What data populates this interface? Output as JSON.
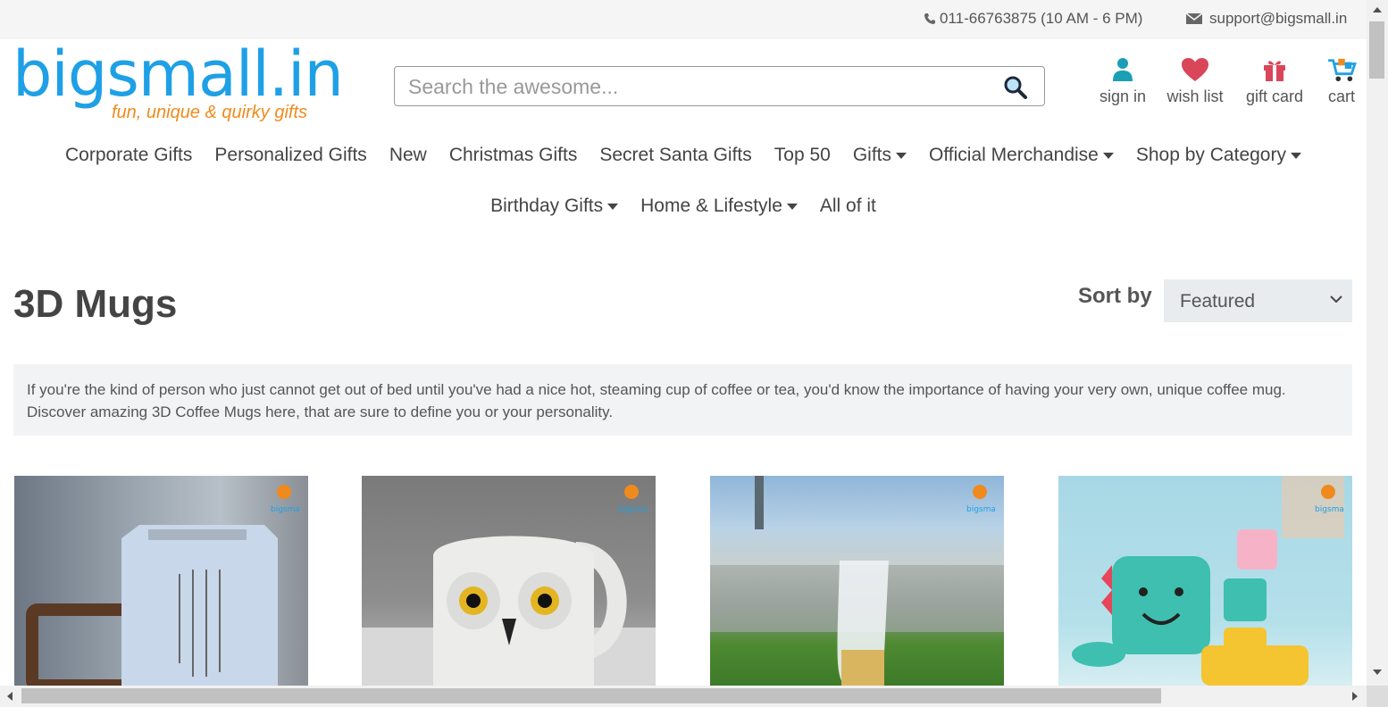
{
  "topbar": {
    "phone": "011-66763875 (10 AM - 6 PM)",
    "email": "support@bigsmall.in"
  },
  "logo": {
    "brand": "bigsmall.in",
    "tagline": "fun, unique & quirky gifts"
  },
  "search": {
    "placeholder": "Search the awesome...",
    "icon": "search-icon"
  },
  "header_links": [
    {
      "label": "sign in",
      "icon": "user-icon"
    },
    {
      "label": "wish list",
      "icon": "heart-icon"
    },
    {
      "label": "gift card",
      "icon": "gift-icon"
    },
    {
      "label": "cart",
      "icon": "cart-icon"
    }
  ],
  "nav": {
    "row1": [
      {
        "label": "Corporate Gifts",
        "dropdown": false
      },
      {
        "label": "Personalized Gifts",
        "dropdown": false
      },
      {
        "label": "New",
        "dropdown": false
      },
      {
        "label": "Christmas Gifts",
        "dropdown": false
      },
      {
        "label": "Secret Santa Gifts",
        "dropdown": false
      },
      {
        "label": "Top 50",
        "dropdown": false
      },
      {
        "label": "Gifts",
        "dropdown": true
      },
      {
        "label": "Official Merchandise",
        "dropdown": true
      },
      {
        "label": "Shop by Category",
        "dropdown": true
      }
    ],
    "row2": [
      {
        "label": "Birthday Gifts",
        "dropdown": true
      },
      {
        "label": "Home & Lifestyle",
        "dropdown": true
      },
      {
        "label": "All of it",
        "dropdown": false
      }
    ]
  },
  "page": {
    "title": "3D Mugs",
    "sort_label": "Sort by",
    "sort_value": "Featured",
    "description": "If you're the kind of person who just cannot get out of bed until you've had a nice hot, steaming cup of coffee or tea, you'd know the importance of having your very own, unique coffee mug. Discover amazing 3D Coffee Mugs here, that are sure to define you or your personality."
  },
  "products": [
    {
      "image": "thor-hammer-mug"
    },
    {
      "image": "owl-mug"
    },
    {
      "image": "boot-glass-mug"
    },
    {
      "image": "dino-kids-set"
    }
  ],
  "colors": {
    "brand_blue": "#1ea0e6",
    "brand_orange": "#f08a1c",
    "icon_teal": "#1a9fb5",
    "icon_red": "#d9465a"
  }
}
